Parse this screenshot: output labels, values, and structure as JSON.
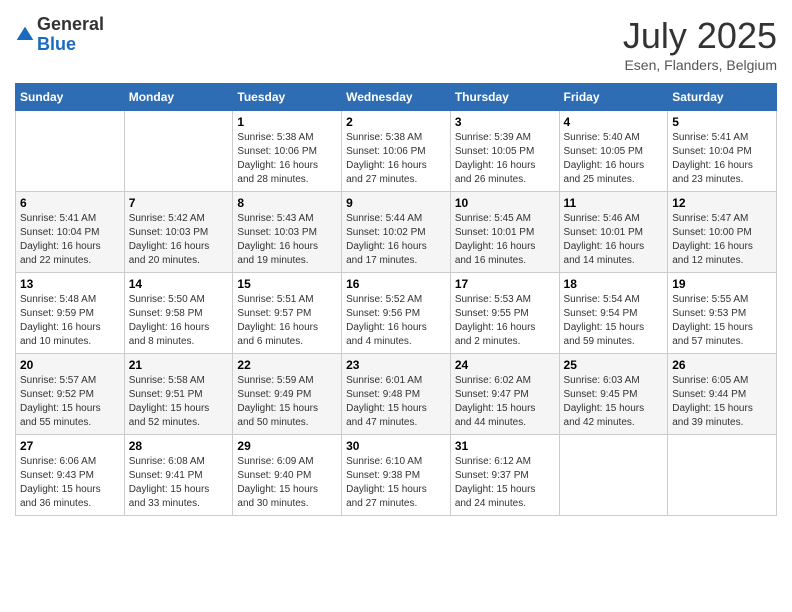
{
  "logo": {
    "general": "General",
    "blue": "Blue"
  },
  "header": {
    "month": "July 2025",
    "location": "Esen, Flanders, Belgium"
  },
  "weekdays": [
    "Sunday",
    "Monday",
    "Tuesday",
    "Wednesday",
    "Thursday",
    "Friday",
    "Saturday"
  ],
  "weeks": [
    [
      {
        "day": null
      },
      {
        "day": null
      },
      {
        "day": 1,
        "sunrise": "5:38 AM",
        "sunset": "10:06 PM",
        "daylight": "16 hours and 28 minutes."
      },
      {
        "day": 2,
        "sunrise": "5:38 AM",
        "sunset": "10:06 PM",
        "daylight": "16 hours and 27 minutes."
      },
      {
        "day": 3,
        "sunrise": "5:39 AM",
        "sunset": "10:05 PM",
        "daylight": "16 hours and 26 minutes."
      },
      {
        "day": 4,
        "sunrise": "5:40 AM",
        "sunset": "10:05 PM",
        "daylight": "16 hours and 25 minutes."
      },
      {
        "day": 5,
        "sunrise": "5:41 AM",
        "sunset": "10:04 PM",
        "daylight": "16 hours and 23 minutes."
      }
    ],
    [
      {
        "day": 6,
        "sunrise": "5:41 AM",
        "sunset": "10:04 PM",
        "daylight": "16 hours and 22 minutes."
      },
      {
        "day": 7,
        "sunrise": "5:42 AM",
        "sunset": "10:03 PM",
        "daylight": "16 hours and 20 minutes."
      },
      {
        "day": 8,
        "sunrise": "5:43 AM",
        "sunset": "10:03 PM",
        "daylight": "16 hours and 19 minutes."
      },
      {
        "day": 9,
        "sunrise": "5:44 AM",
        "sunset": "10:02 PM",
        "daylight": "16 hours and 17 minutes."
      },
      {
        "day": 10,
        "sunrise": "5:45 AM",
        "sunset": "10:01 PM",
        "daylight": "16 hours and 16 minutes."
      },
      {
        "day": 11,
        "sunrise": "5:46 AM",
        "sunset": "10:01 PM",
        "daylight": "16 hours and 14 minutes."
      },
      {
        "day": 12,
        "sunrise": "5:47 AM",
        "sunset": "10:00 PM",
        "daylight": "16 hours and 12 minutes."
      }
    ],
    [
      {
        "day": 13,
        "sunrise": "5:48 AM",
        "sunset": "9:59 PM",
        "daylight": "16 hours and 10 minutes."
      },
      {
        "day": 14,
        "sunrise": "5:50 AM",
        "sunset": "9:58 PM",
        "daylight": "16 hours and 8 minutes."
      },
      {
        "day": 15,
        "sunrise": "5:51 AM",
        "sunset": "9:57 PM",
        "daylight": "16 hours and 6 minutes."
      },
      {
        "day": 16,
        "sunrise": "5:52 AM",
        "sunset": "9:56 PM",
        "daylight": "16 hours and 4 minutes."
      },
      {
        "day": 17,
        "sunrise": "5:53 AM",
        "sunset": "9:55 PM",
        "daylight": "16 hours and 2 minutes."
      },
      {
        "day": 18,
        "sunrise": "5:54 AM",
        "sunset": "9:54 PM",
        "daylight": "15 hours and 59 minutes."
      },
      {
        "day": 19,
        "sunrise": "5:55 AM",
        "sunset": "9:53 PM",
        "daylight": "15 hours and 57 minutes."
      }
    ],
    [
      {
        "day": 20,
        "sunrise": "5:57 AM",
        "sunset": "9:52 PM",
        "daylight": "15 hours and 55 minutes."
      },
      {
        "day": 21,
        "sunrise": "5:58 AM",
        "sunset": "9:51 PM",
        "daylight": "15 hours and 52 minutes."
      },
      {
        "day": 22,
        "sunrise": "5:59 AM",
        "sunset": "9:49 PM",
        "daylight": "15 hours and 50 minutes."
      },
      {
        "day": 23,
        "sunrise": "6:01 AM",
        "sunset": "9:48 PM",
        "daylight": "15 hours and 47 minutes."
      },
      {
        "day": 24,
        "sunrise": "6:02 AM",
        "sunset": "9:47 PM",
        "daylight": "15 hours and 44 minutes."
      },
      {
        "day": 25,
        "sunrise": "6:03 AM",
        "sunset": "9:45 PM",
        "daylight": "15 hours and 42 minutes."
      },
      {
        "day": 26,
        "sunrise": "6:05 AM",
        "sunset": "9:44 PM",
        "daylight": "15 hours and 39 minutes."
      }
    ],
    [
      {
        "day": 27,
        "sunrise": "6:06 AM",
        "sunset": "9:43 PM",
        "daylight": "15 hours and 36 minutes."
      },
      {
        "day": 28,
        "sunrise": "6:08 AM",
        "sunset": "9:41 PM",
        "daylight": "15 hours and 33 minutes."
      },
      {
        "day": 29,
        "sunrise": "6:09 AM",
        "sunset": "9:40 PM",
        "daylight": "15 hours and 30 minutes."
      },
      {
        "day": 30,
        "sunrise": "6:10 AM",
        "sunset": "9:38 PM",
        "daylight": "15 hours and 27 minutes."
      },
      {
        "day": 31,
        "sunrise": "6:12 AM",
        "sunset": "9:37 PM",
        "daylight": "15 hours and 24 minutes."
      },
      {
        "day": null
      },
      {
        "day": null
      }
    ]
  ],
  "labels": {
    "sunrise": "Sunrise:",
    "sunset": "Sunset:",
    "daylight": "Daylight:"
  }
}
